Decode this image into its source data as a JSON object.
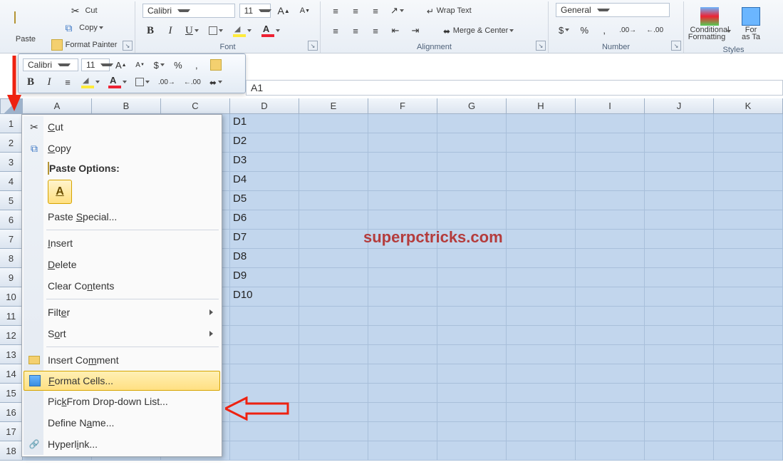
{
  "ribbon": {
    "clipboard": {
      "paste": "Paste",
      "cut": "Cut",
      "copy": "Copy",
      "format_painter": "Format Painter"
    },
    "font": {
      "combo_font": "Calibri",
      "combo_size": "11",
      "group": "Font"
    },
    "alignment": {
      "wrap": "Wrap Text",
      "merge": "Merge & Center",
      "group": "Alignment"
    },
    "number": {
      "format": "General",
      "group": "Number"
    },
    "styles": {
      "cond": "Conditional",
      "cond2": "Formatting",
      "fmt_as_tbl1": "For",
      "fmt_as_tbl2": "as Ta",
      "group": "Styles"
    }
  },
  "mini_toolbar": {
    "font": "Calibri",
    "size": "11",
    "percent": "%",
    "comma": ","
  },
  "namebox": "A1",
  "columns": [
    "A",
    "B",
    "C",
    "D",
    "E",
    "F",
    "G",
    "H",
    "I",
    "J",
    "K"
  ],
  "rows": [
    1,
    2,
    3,
    4,
    5,
    6,
    7,
    8,
    9,
    10,
    11,
    12,
    13,
    14,
    15,
    16,
    17,
    18
  ],
  "cells_col_d": [
    "D1",
    "D2",
    "D3",
    "D4",
    "D5",
    "D6",
    "D7",
    "D8",
    "D9",
    "D10"
  ],
  "context_menu": {
    "cut": "Cut",
    "copy": "Copy",
    "paste_header": "Paste Options:",
    "paste_special": "Paste Special...",
    "insert": "Insert",
    "delete": "Delete",
    "clear": "Clear Contents",
    "filter": "Filter",
    "sort": "Sort",
    "insert_comment": "Insert Comment",
    "format_cells": "Format Cells...",
    "pick_list": "Pick From Drop-down List...",
    "define_name": "Define Name...",
    "hyperlink": "Hyperlink..."
  },
  "watermark": "superpctricks.com"
}
